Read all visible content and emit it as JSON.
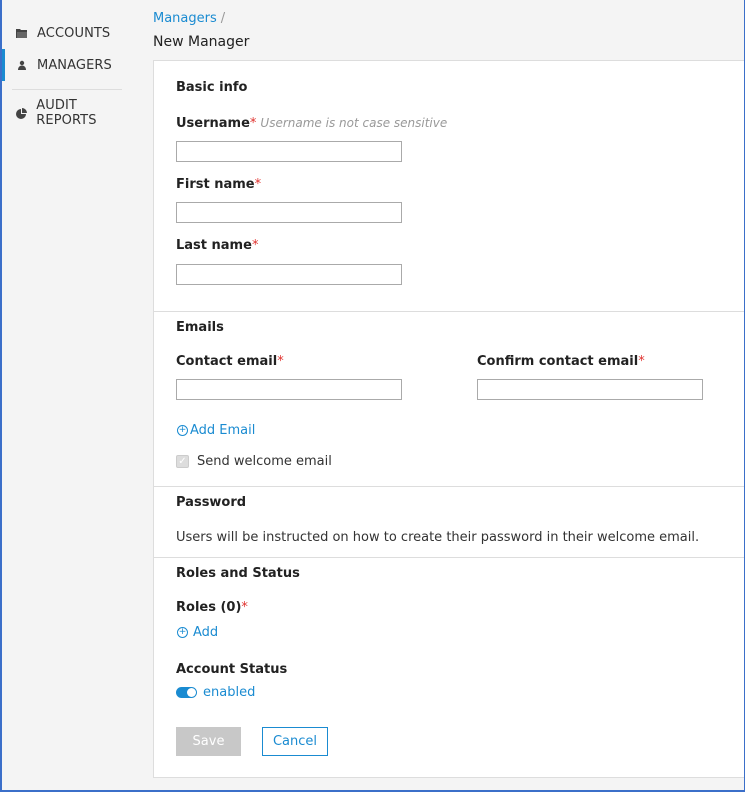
{
  "sidebar": {
    "items": [
      {
        "label": "ACCOUNTS",
        "icon": "folder-icon"
      },
      {
        "label": "MANAGERS",
        "icon": "user-icon"
      },
      {
        "label": "AUDIT REPORTS",
        "icon": "pie-chart-icon"
      }
    ],
    "active_index": 1
  },
  "breadcrumb": {
    "parent": "Managers",
    "separator": "/"
  },
  "page_title": "New Manager",
  "basic_info": {
    "title": "Basic info",
    "username_label": "Username",
    "username_hint": "Username is not case sensitive",
    "username_value": "",
    "first_name_label": "First name",
    "first_name_value": "",
    "last_name_label": "Last name",
    "last_name_value": "",
    "required_mark": "*"
  },
  "emails": {
    "title": "Emails",
    "contact_label": "Contact email",
    "confirm_label": "Confirm contact email",
    "contact_value": "",
    "confirm_value": "",
    "add_email_label": "Add Email",
    "send_welcome_label": "Send welcome email",
    "send_welcome_checked": true
  },
  "password": {
    "title": "Password",
    "description": "Users will be instructed on how to create their password in their welcome email."
  },
  "roles_status": {
    "title": "Roles and Status",
    "roles_label": "Roles (0)",
    "add_label": "Add",
    "account_status_label": "Account Status",
    "status_value": "enabled"
  },
  "actions": {
    "save_label": "Save",
    "cancel_label": "Cancel"
  },
  "colors": {
    "accent": "#1a8bd1",
    "required": "#e0312d",
    "disabled_button": "#c8c8c8"
  }
}
